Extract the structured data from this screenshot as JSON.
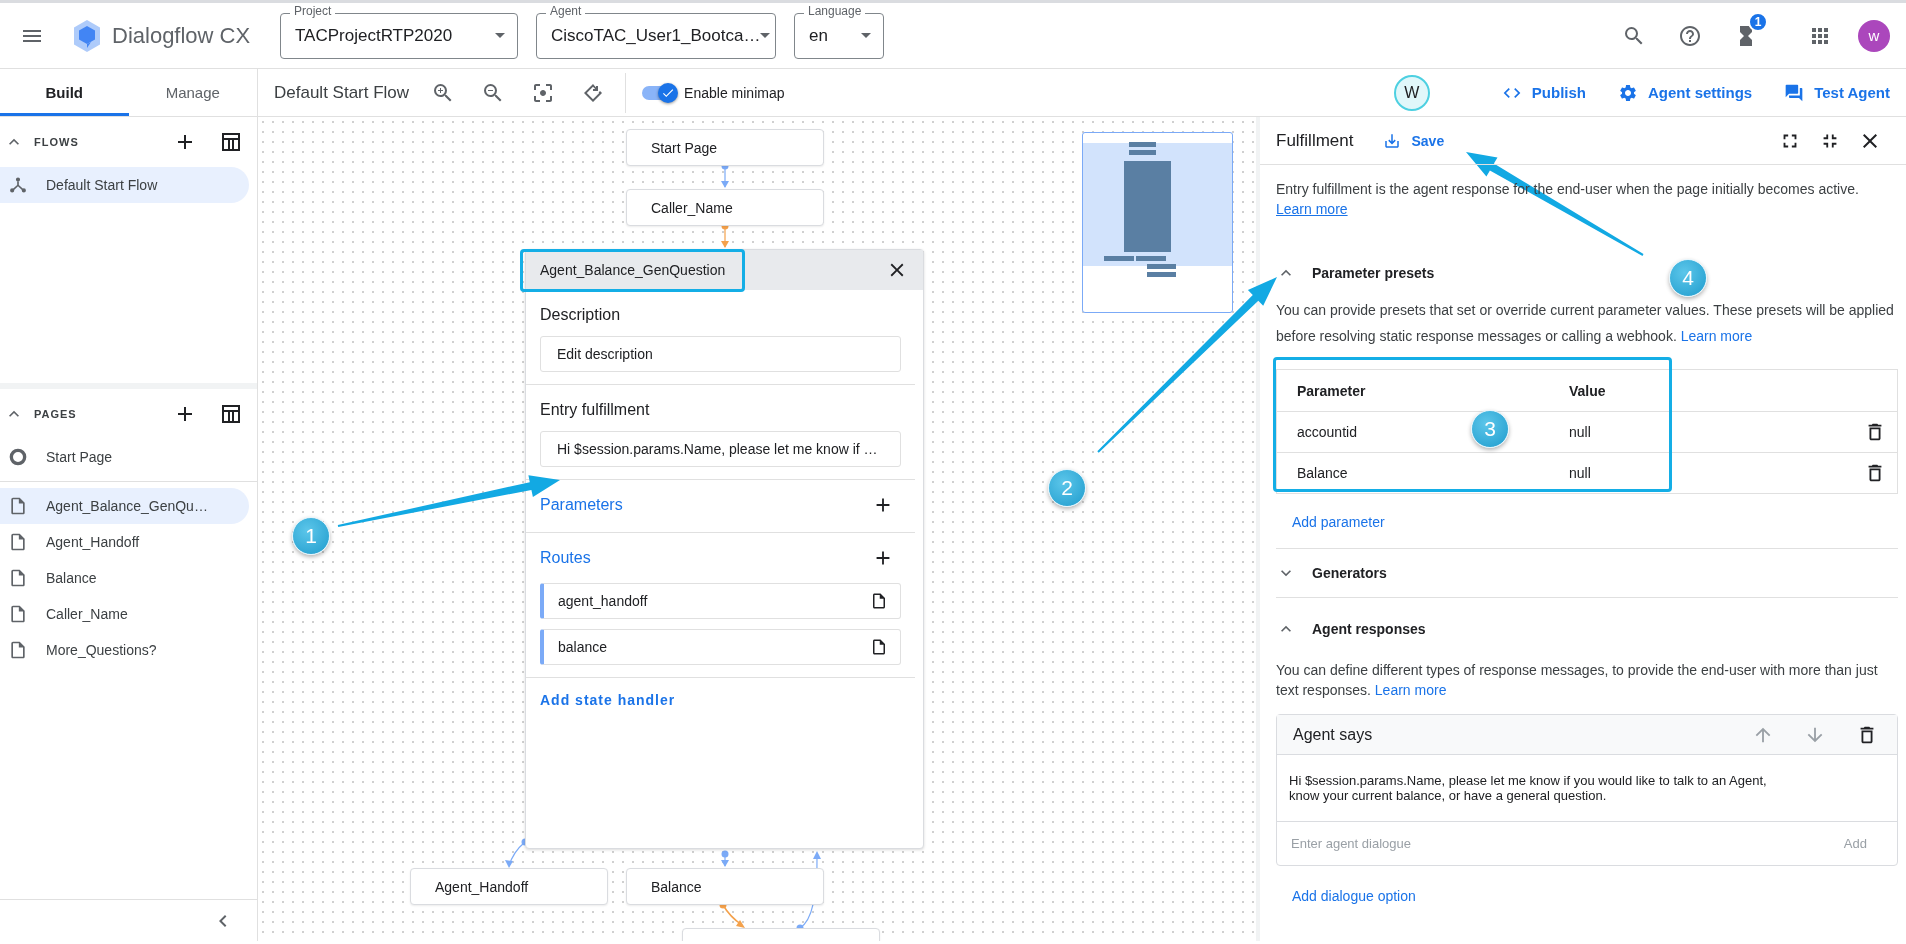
{
  "header": {
    "product": "Dialogflow CX",
    "selectors": [
      {
        "label": "Project",
        "value": "TACProjectRTP2020"
      },
      {
        "label": "Agent",
        "value": "CiscoTAC_User1_Bootca…"
      },
      {
        "label": "Language",
        "value": "en"
      }
    ],
    "notification_count": "1",
    "avatar": "w"
  },
  "nav_tabs": [
    {
      "label": "Build",
      "selected": true
    },
    {
      "label": "Manage",
      "selected": false
    }
  ],
  "toolbar": {
    "flow_title": "Default Start Flow",
    "minimap_toggle": {
      "label": "Enable minimap",
      "on": true
    },
    "collaborator": "W",
    "actions": [
      {
        "label": "Publish",
        "kind": "code"
      },
      {
        "label": "Agent settings",
        "kind": "gear"
      },
      {
        "label": "Test Agent",
        "kind": "chat"
      }
    ]
  },
  "sidebar": {
    "sections": [
      {
        "title": "FLOWS",
        "items": [
          {
            "label": "Default Start Flow",
            "kind": "flow",
            "selected": true
          }
        ]
      },
      {
        "title": "PAGES",
        "items": [
          {
            "label": "Start Page",
            "kind": "start",
            "selected": false
          },
          {
            "label": "Agent_Balance_GenQu…",
            "kind": "page",
            "selected": true
          },
          {
            "label": "Agent_Handoff",
            "kind": "page",
            "selected": false
          },
          {
            "label": "Balance",
            "kind": "page",
            "selected": false
          },
          {
            "label": "Caller_Name",
            "kind": "page",
            "selected": false
          },
          {
            "label": "More_Questions?",
            "kind": "page",
            "selected": false
          }
        ]
      }
    ]
  },
  "canvas": {
    "nodes": [
      {
        "label": "Start Page"
      },
      {
        "label": "Caller_Name"
      },
      {
        "label": "Agent_Handoff"
      },
      {
        "label": "Balance"
      }
    ],
    "page_card": {
      "title": "Agent_Balance_GenQuestion",
      "description_label": "Description",
      "description_value": "Edit description",
      "entry_label": "Entry fulfillment",
      "entry_value": "Hi $session.params.Name, please let me know if …",
      "parameters_label": "Parameters",
      "routes_label": "Routes",
      "routes": [
        "agent_handoff",
        "balance"
      ],
      "add_state_handler": "Add state handler"
    }
  },
  "fulfillment_panel": {
    "title": "Fulfillment",
    "save": "Save",
    "intro": "Entry fulfillment is the agent response for the end-user when the page initially becomes active.",
    "intro_link": "Learn more",
    "parameter_presets": {
      "title": "Parameter presets",
      "expanded": true,
      "description": "You can provide presets that set or override current parameter values. These presets will be applied before resolving static response messages or calling a webhook.",
      "link": "Learn more",
      "columns": [
        "Parameter",
        "Value"
      ],
      "rows": [
        {
          "parameter": "accountid",
          "value": "null"
        },
        {
          "parameter": "Balance",
          "value": "null"
        }
      ],
      "add_label": "Add parameter"
    },
    "generators": {
      "title": "Generators",
      "expanded": false
    },
    "agent_responses": {
      "title": "Agent responses",
      "expanded": true,
      "description": "You can define different types of response messages, to provide the end-user with more than just text responses.",
      "link": "Learn more",
      "card_title": "Agent says",
      "message": "Hi $session.params.Name, please let me know if you would like to talk to an Agent,\nknow your current balance, or have a general question.",
      "placeholder": "Enter agent dialogue",
      "add_label": "Add",
      "add_option": "Add dialogue option"
    }
  },
  "callouts": [
    {
      "number": "1"
    },
    {
      "number": "2"
    },
    {
      "number": "3"
    },
    {
      "number": "4"
    }
  ]
}
